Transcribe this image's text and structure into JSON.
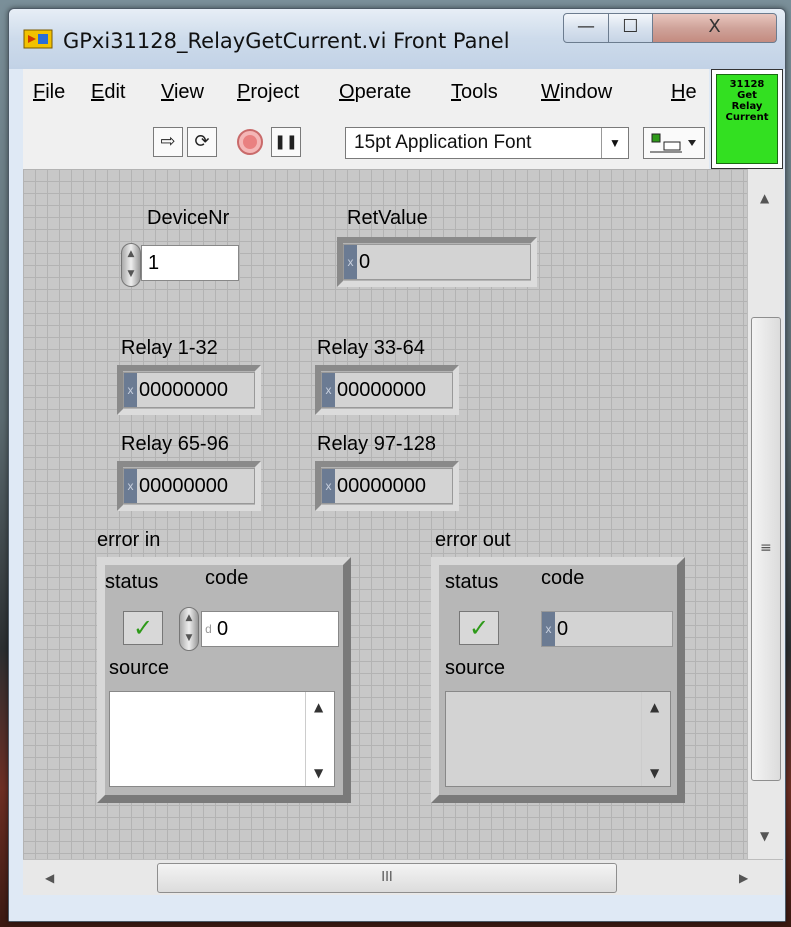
{
  "window": {
    "title": "GPxi31128_RelayGetCurrent.vi Front Panel",
    "controls": {
      "minimize": "—",
      "maximize": "☐",
      "close": "X"
    }
  },
  "menu": {
    "items": [
      {
        "accel": "F",
        "rest": "ile"
      },
      {
        "accel": "E",
        "rest": "dit"
      },
      {
        "accel": "V",
        "rest": "iew"
      },
      {
        "accel": "P",
        "rest": "roject"
      },
      {
        "accel": "O",
        "rest": "perate"
      },
      {
        "accel": "T",
        "rest": "ools"
      },
      {
        "accel": "W",
        "rest": "indow"
      },
      {
        "accel": "H",
        "rest": "e"
      }
    ]
  },
  "toolbar": {
    "run_icon": "⇨",
    "run_continuous_icon": "⟳",
    "pause_icon": "❚❚",
    "font_label": "15pt Application Font",
    "font_arrow": "▼"
  },
  "vi_icon": {
    "lines": [
      "31128",
      "Get",
      "Relay",
      "Current"
    ],
    "color": "#33e021"
  },
  "panel": {
    "device_nr": {
      "label": "DeviceNr",
      "value": "1"
    },
    "ret_value": {
      "label": "RetValue",
      "value": "0",
      "radix": "x"
    },
    "relays": [
      {
        "label": "Relay 1-32",
        "value": "00000000",
        "radix": "x"
      },
      {
        "label": "Relay 33-64",
        "value": "00000000",
        "radix": "x"
      },
      {
        "label": "Relay 65-96",
        "value": "00000000",
        "radix": "x"
      },
      {
        "label": "Relay 97-128",
        "value": "00000000",
        "radix": "x"
      }
    ],
    "error_in": {
      "label": "error in",
      "status_label": "status",
      "code_label": "code",
      "status_glyph": "✓",
      "code_value": "0",
      "code_radix": "d",
      "source_label": "source"
    },
    "error_out": {
      "label": "error out",
      "status_label": "status",
      "code_label": "code",
      "status_glyph": "✓",
      "code_value": "0",
      "code_radix": "x",
      "source_label": "source"
    }
  },
  "scrollbars": {
    "h_thumb_grip": "III",
    "up": "▲",
    "down": "▼",
    "left": "◀",
    "right": "▶",
    "v_grip": "≡"
  }
}
